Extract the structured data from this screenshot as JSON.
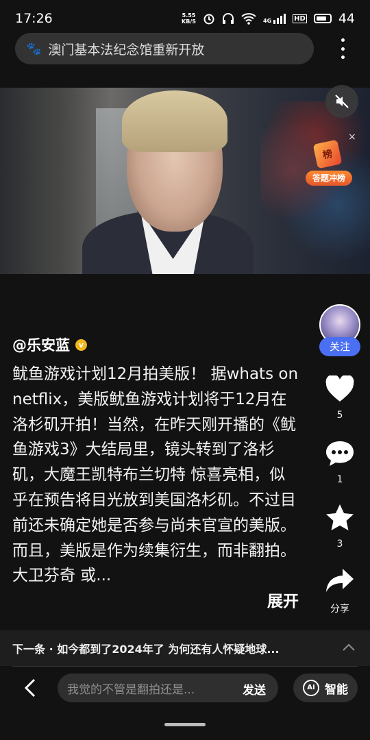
{
  "status": {
    "time": "17:26",
    "net_speed_value": "5.55",
    "net_speed_unit": "KB/S",
    "network": "4G",
    "hd": "HD",
    "battery": "44"
  },
  "search": {
    "query": "澳门基本法纪念馆重新开放"
  },
  "quiz_badge": {
    "flag_text": "榜",
    "label": "答题冲榜",
    "close": "×"
  },
  "post": {
    "author": "@乐安蓝",
    "verified_mark": "v",
    "text": "鱿鱼游戏计划12月拍美版！ 据whats on netflix，美版鱿鱼游戏计划将于12月在洛杉矶开拍！当然，在昨天刚开播的《鱿鱼游戏3》大结局里，镜头转到了洛杉矶，大魔王凯特布兰切特 惊喜亮相，似乎在预告将目光放到美国洛杉矶。不过目前还未确定她是否参与尚未官宣的美版。 而且，美版是作为续集衍生，而非翻拍。大卫芬奇 或...",
    "expand": "展开"
  },
  "sidebar": {
    "follow": "关注",
    "likes": "5",
    "comments": "1",
    "favorites": "3",
    "share": "分享"
  },
  "next": {
    "text": "下一条 · 如今都到了2024年了 为何还有人怀疑地球..."
  },
  "bottom": {
    "comment_placeholder": "我觉的不管是翻拍还是...",
    "send": "发送",
    "ai_logo": "AI",
    "ai_label": "智能"
  },
  "colors": {
    "background": "#121212",
    "follow_button": "#4a6ff2",
    "verified": "#f2b71e",
    "quiz_badge": "#e4572a"
  }
}
